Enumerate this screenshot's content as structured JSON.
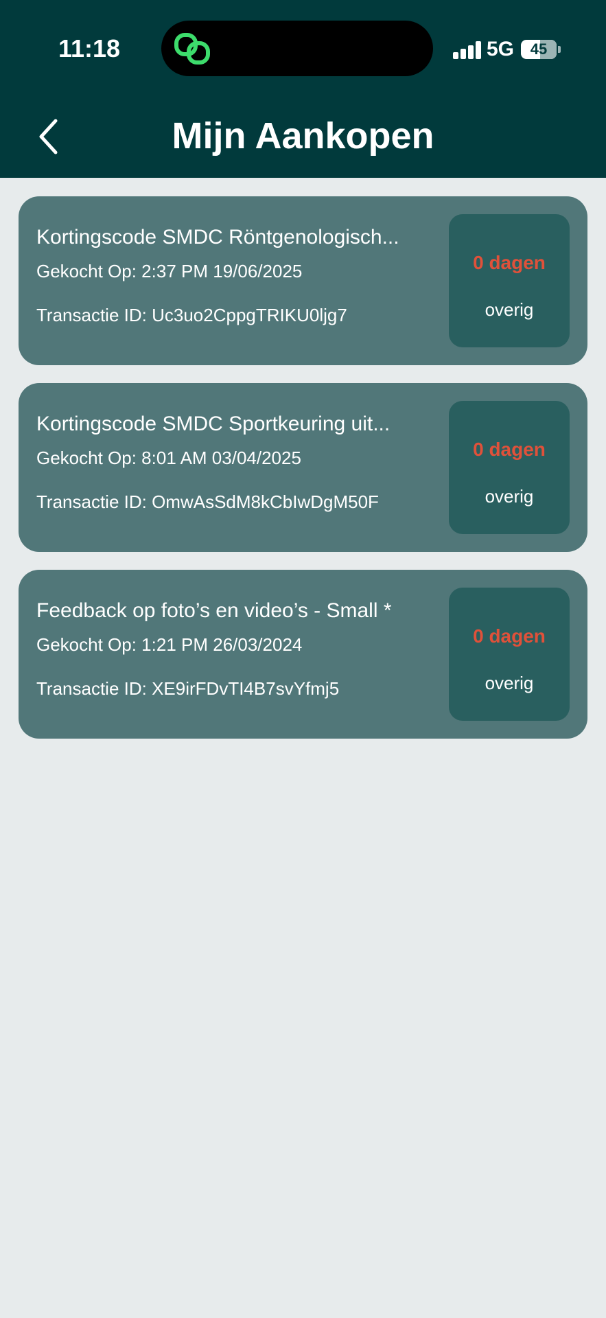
{
  "status_bar": {
    "time": "11:18",
    "network": "5G",
    "battery": "45"
  },
  "header": {
    "title": "Mijn Aankopen",
    "back_icon": "chevron-left-icon"
  },
  "purchases": [
    {
      "title": "Kortingscode SMDC Röntgenologisch...",
      "bought": "Gekocht Op: 2:37 PM 19/06/2025",
      "transaction": "Transactie ID: Uc3uo2CppgTRIKU0ljg7",
      "days": "0 dagen",
      "remaining_label": "overig"
    },
    {
      "title": "Kortingscode SMDC Sportkeuring uit...",
      "bought": "Gekocht Op: 8:01 AM 03/04/2025",
      "transaction": "Transactie ID: OmwAsSdM8kCbIwDgM50F",
      "days": "0 dagen",
      "remaining_label": "overig"
    },
    {
      "title": "Feedback op foto’s en video’s - Small *",
      "bought": "Gekocht Op: 1:21 PM 26/03/2024",
      "transaction": "Transactie ID: XE9irFDvTI4B7svYfmj5",
      "days": "0 dagen",
      "remaining_label": "overig"
    }
  ],
  "colors": {
    "header_bg": "#013a3c",
    "page_bg": "#e7ebec",
    "card_bg": "#517779",
    "badge_bg": "#295f5f",
    "days_text": "#e0513a",
    "island_icon": "#3ddc6c"
  }
}
